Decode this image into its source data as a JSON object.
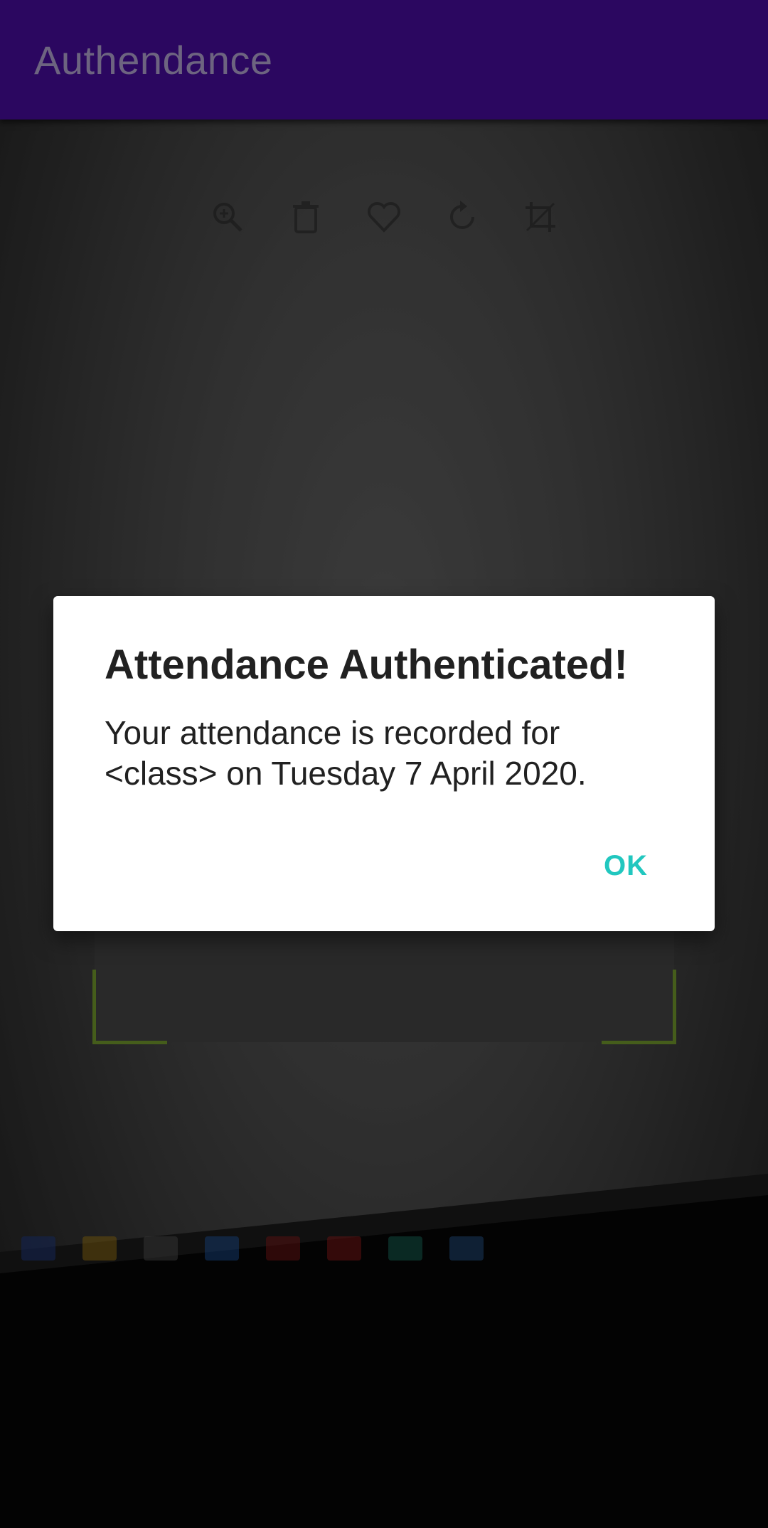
{
  "app_bar": {
    "title": "Authendance"
  },
  "camera_view": {
    "toolbar_icons": [
      "zoom-in-icon",
      "trash-icon",
      "heart-icon",
      "rotate-icon",
      "crop-icon"
    ],
    "scan_frame_color": "#6b8f2a"
  },
  "dialog": {
    "title": "Attendance Authenticated!",
    "message": "Your attendance is recorded for <class> on Tuesday 7 April 2020.",
    "ok_label": "OK",
    "accent_color": "#21c7bf"
  },
  "colors": {
    "primary": "#2b0760",
    "title_text": "#6d6480"
  }
}
